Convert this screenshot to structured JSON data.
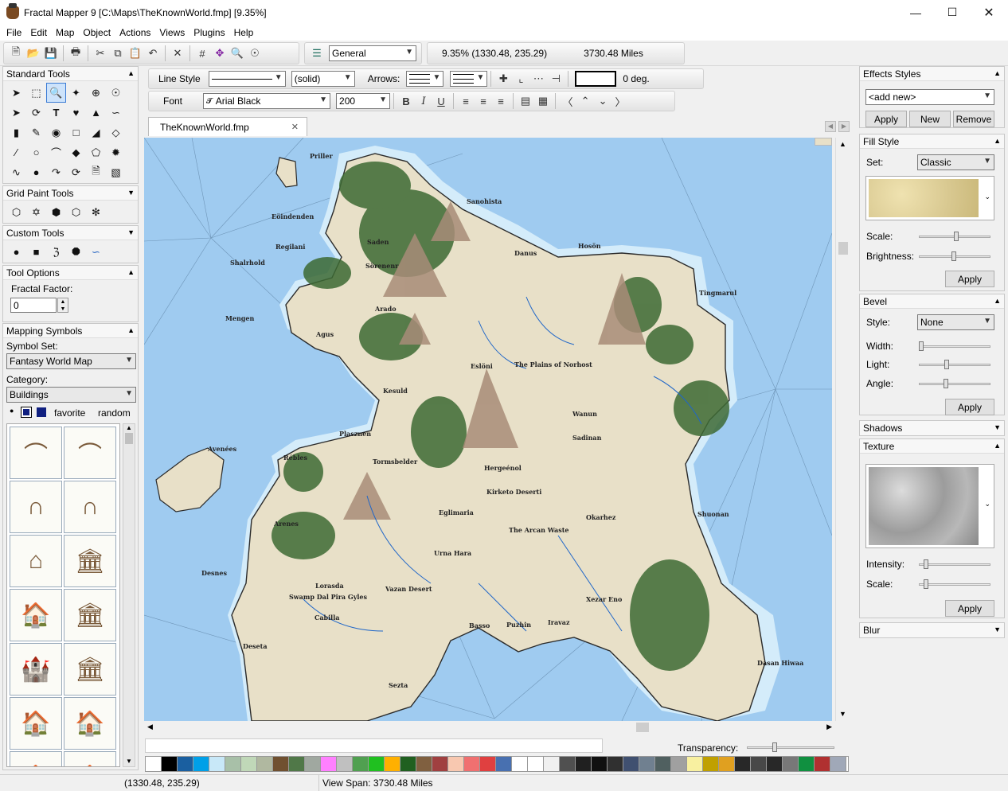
{
  "window": {
    "title": "Fractal Mapper 9 [C:\\Maps\\TheKnownWorld.fmp] [9.35%]"
  },
  "menu": [
    "File",
    "Edit",
    "Map",
    "Object",
    "Actions",
    "Views",
    "Plugins",
    "Help"
  ],
  "toolbar": {
    "layer_select": "General",
    "zoom_readout": "9.35%  (1330.48, 235.29)",
    "distance_readout": "3730.48 Miles"
  },
  "line_toolbar": {
    "line_style_label": "Line Style",
    "style_value": "(solid)",
    "arrows_label": "Arrows:",
    "angle_value": "0 deg."
  },
  "font_toolbar": {
    "font_label": "Font",
    "font_value": "Arial Black",
    "size_value": "200"
  },
  "tab": {
    "label": "TheKnownWorld.fmp"
  },
  "left_panels": {
    "standard_tools": "Standard Tools",
    "grid_paint_tools": "Grid Paint Tools",
    "custom_tools": "Custom Tools",
    "tool_options": "Tool Options",
    "fractal_factor_label": "Fractal Factor:",
    "fractal_factor_value": "0",
    "mapping_symbols": "Mapping Symbols",
    "symbol_set_label": "Symbol Set:",
    "symbol_set_value": "Fantasy World Map",
    "category_label": "Category:",
    "category_value": "Buildings",
    "favorite": "favorite",
    "random": "random"
  },
  "right_panels": {
    "effects_styles": "Effects Styles",
    "add_new": "<add new>",
    "apply": "Apply",
    "new": "New",
    "remove": "Remove",
    "fill_style": "Fill Style",
    "set_label": "Set:",
    "set_value": "Classic",
    "scale_label": "Scale:",
    "brightness_label": "Brightness:",
    "bevel": "Bevel",
    "style_label": "Style:",
    "style_value": "None",
    "width_label": "Width:",
    "light_label": "Light:",
    "angle_label": "Angle:",
    "shadows": "Shadows",
    "texture": "Texture",
    "intensity_label": "Intensity:",
    "blur": "Blur"
  },
  "palette": {
    "transparency_label": "Transparency:"
  },
  "status": {
    "coords": "(1330.48, 235.29)",
    "view_span": "View Span: 3730.48 Miles"
  },
  "map_labels": [
    "Priller",
    "Sanohista",
    "Eöindenden",
    "Regilani",
    "Saden",
    "Sörenenr",
    "Hosön",
    "Danus",
    "Shalrhold",
    "Mengen",
    "Agus",
    "Arado",
    "Tingmarul",
    "Eslöni",
    "The Plains of Norhost",
    "Kesuld",
    "Wanun",
    "Plasznen",
    "Sadinan",
    "Avenées",
    "Rébles",
    "Tormsbelder",
    "Hergeénol",
    "Kirketo Deserti",
    "Eglimaria",
    "Okarhez",
    "Shuonan",
    "Arenes",
    "Lorasda",
    "The Arcan Waste",
    "Urna Hara",
    "Desnes",
    "Swamp Dal Pira Gyles",
    "Cabilla",
    "Vazan Desert",
    "Xezar Eno",
    "Deseta",
    "Basso",
    "Puzhin",
    "Iravaz",
    "Dasan Hiwaa",
    "Sezta"
  ],
  "palette_colors": [
    "#ffffff",
    "#000000",
    "#1a5fa0",
    "#00a0e8",
    "#c8e8f8",
    "#a8c0a8",
    "#c0d8b8",
    "#b0b8a0",
    "#705030",
    "#507848",
    "#a0a8a0",
    "#ff80ff",
    "#c0c0c0",
    "#50a050",
    "#20c020",
    "#ffb000",
    "#206020",
    "#806040",
    "#a04040",
    "#f8c8b0",
    "#f07070",
    "#e04040",
    "#4870b0",
    "#ffffff",
    "#ffffff",
    "#f0f0f0",
    "#505050",
    "#202020",
    "#101010",
    "#303030",
    "#405070",
    "#708090",
    "#506060",
    "#a0a0a0",
    "#f8f0a0",
    "#c0a000",
    "#e0a020",
    "#282828",
    "#484848",
    "#282828",
    "#787878",
    "#109040",
    "#b03030",
    "#a0a8b8"
  ]
}
